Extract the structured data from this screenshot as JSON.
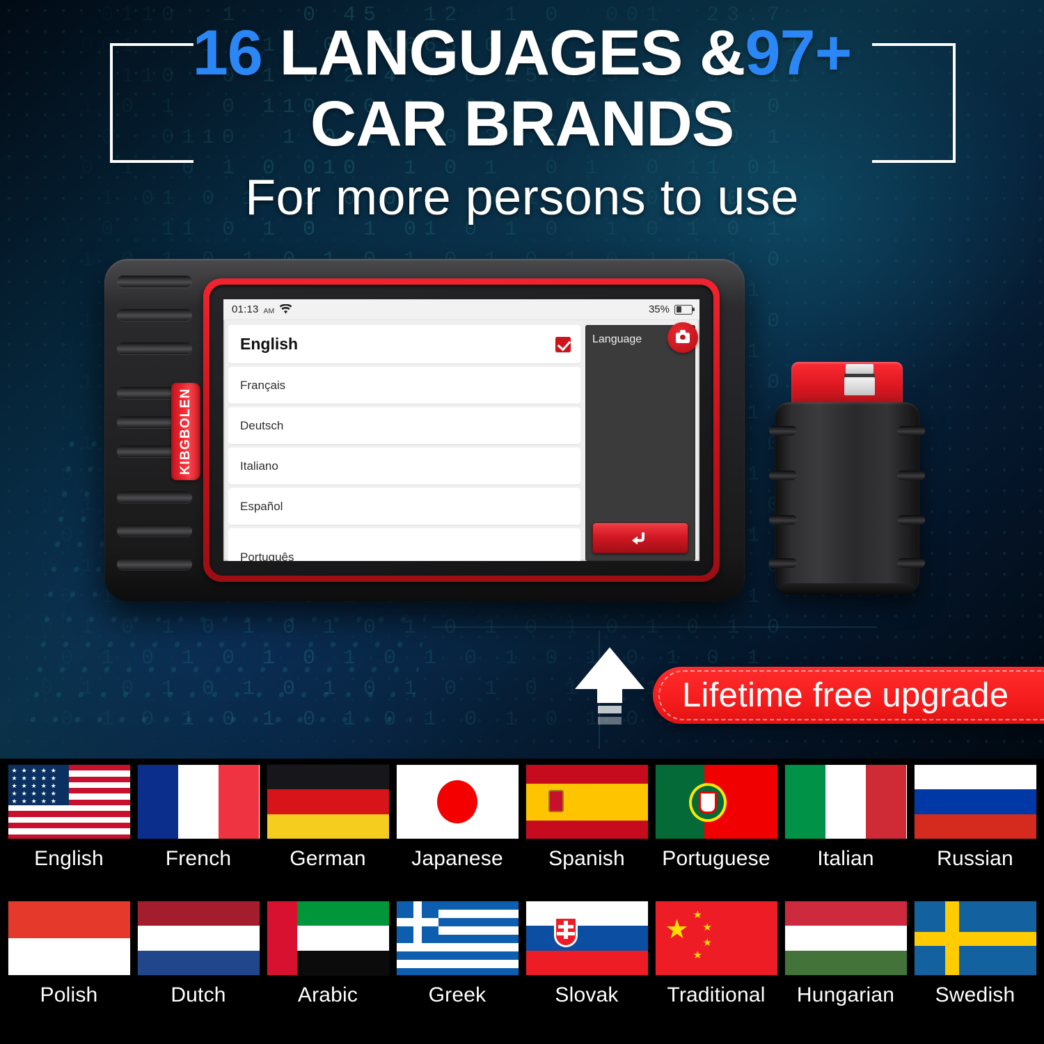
{
  "headline": {
    "line1_pre": "16",
    "line1_mid": " LANGUAGES &",
    "line1_post": "97+",
    "line2": "CAR BRANDS",
    "accent_color": "#2a87f5"
  },
  "subtitle": "For more persons to use",
  "device": {
    "brand": "KIBGBOLEN",
    "statusbar": {
      "time": "01:13",
      "ampm": "AM",
      "wifi_icon": "wifi-icon",
      "battery_percent": "35%",
      "battery_icon": "battery-icon"
    },
    "languages": [
      {
        "label": "English",
        "selected": true
      },
      {
        "label": "Français",
        "selected": false
      },
      {
        "label": "Deutsch",
        "selected": false
      },
      {
        "label": "Italiano",
        "selected": false
      },
      {
        "label": "Español",
        "selected": false
      },
      {
        "label": "Português",
        "selected": false
      }
    ],
    "panel": {
      "title": "Language",
      "camera_icon": "camera-icon",
      "back_icon": "back-arrow-icon"
    }
  },
  "dongle": {
    "name": "obd-connector"
  },
  "badge": {
    "label": "Lifetime free upgrade",
    "color": "#f61d1d"
  },
  "arrow": {
    "name": "upward-arrow"
  },
  "flags": {
    "row1": [
      {
        "label": "English",
        "flag": "us-flag"
      },
      {
        "label": "French",
        "flag": "france-flag"
      },
      {
        "label": "German",
        "flag": "germany-flag"
      },
      {
        "label": "Japanese",
        "flag": "japan-flag"
      },
      {
        "label": "Spanish",
        "flag": "spain-flag"
      },
      {
        "label": "Portuguese",
        "flag": "portugal-flag"
      },
      {
        "label": "Italian",
        "flag": "italy-flag"
      },
      {
        "label": "Russian",
        "flag": "russia-flag"
      }
    ],
    "row2": [
      {
        "label": "Polish",
        "flag": "poland-flag"
      },
      {
        "label": "Dutch",
        "flag": "netherlands-flag"
      },
      {
        "label": "Arabic",
        "flag": "uae-flag"
      },
      {
        "label": "Greek",
        "flag": "greece-flag"
      },
      {
        "label": "Slovak",
        "flag": "slovakia-flag"
      },
      {
        "label": "Traditional",
        "flag": "china-flag"
      },
      {
        "label": "Hungarian",
        "flag": "hungary-flag"
      },
      {
        "label": "Swedish",
        "flag": "sweden-flag"
      }
    ]
  }
}
